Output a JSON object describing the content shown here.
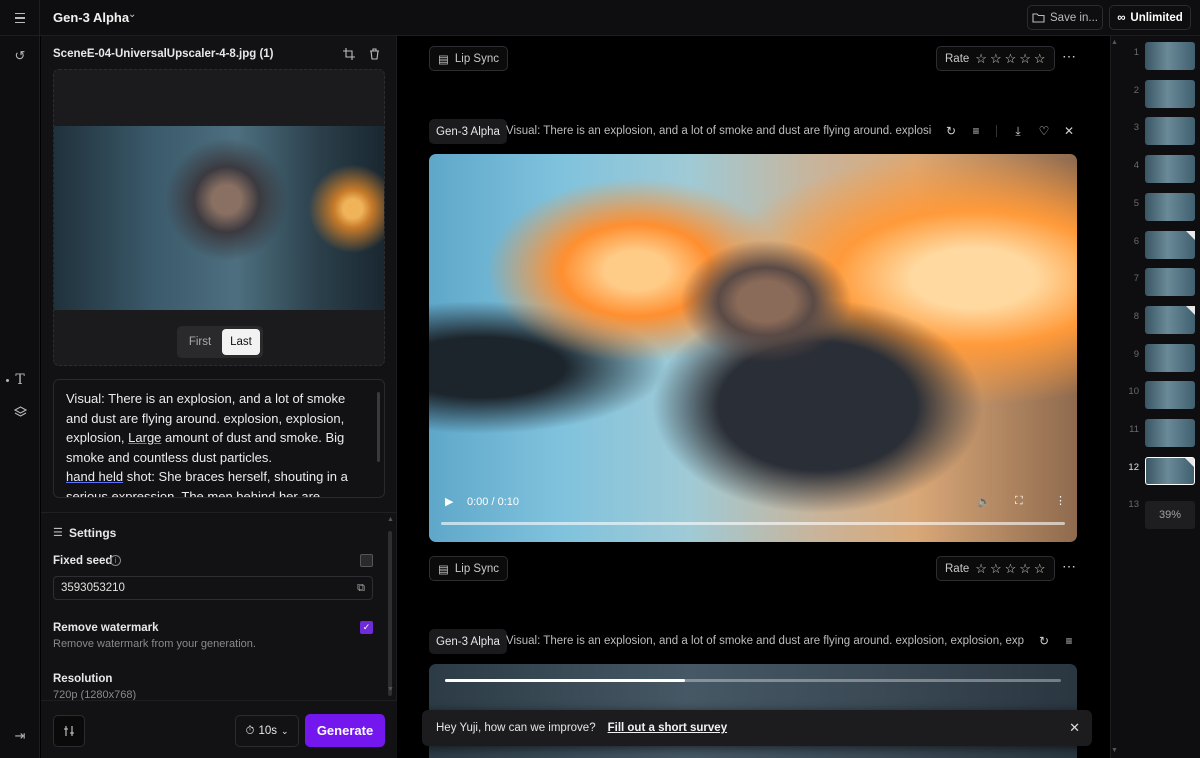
{
  "topbar": {
    "model_title": "Gen-3 Alpha",
    "save_label": "Save in...",
    "plan_label": "Unlimited"
  },
  "left_panel": {
    "file_name": "SceneE-04-UniversalUpscaler-4-8.jpg (1)",
    "frame_toggle": {
      "first": "First",
      "last": "Last",
      "selected": "Last"
    },
    "prompt_lines": [
      "Visual: There is an explosion, and a lot of smoke",
      "and dust are flying around. explosion, explosion,",
      "explosion, ",
      "Large",
      " amount of dust and smoke. Big",
      "smoke and countless dust particles.",
      "hand held",
      " shot: She braces herself, shouting in a",
      "serious expression. The men behind her are"
    ],
    "settings": {
      "title": "Settings",
      "fixed_seed_label": "Fixed seed",
      "fixed_seed_checked": false,
      "seed_value": "3593053210",
      "remove_watermark_label": "Remove watermark",
      "remove_watermark_desc": "Remove watermark from your generation.",
      "remove_watermark_checked": true,
      "resolution_label": "Resolution",
      "resolution_value": "720p (1280x768)"
    },
    "duration": "10s",
    "generate_label": "Generate"
  },
  "main": {
    "lip_sync_label": "Lip Sync",
    "rate_label": "Rate",
    "rating": 0,
    "generation1": {
      "model": "Gen-3 Alpha",
      "prompt": "Visual: There is an explosion, and a lot of smoke and dust are flying around. explosion,...",
      "time": "0:00 / 0:10"
    },
    "generation2": {
      "model": "Gen-3 Alpha",
      "prompt": "Visual: There is an explosion, and a lot of smoke and dust are flying around. explosion, explosion, explosi...",
      "progress": 0.39
    }
  },
  "toast": {
    "message": "Hey Yuji, how can we improve?",
    "link": "Fill out a short survey"
  },
  "timeline": {
    "numbers": [
      "1",
      "2",
      "3",
      "4",
      "5",
      "6",
      "7",
      "8",
      "9",
      "10",
      "11",
      "12",
      "13"
    ],
    "selected": "12",
    "progress_label": "39%"
  },
  "colors": {
    "accent": "#7417ee",
    "checkbox": "#6d2bd9",
    "background": "#000000"
  }
}
